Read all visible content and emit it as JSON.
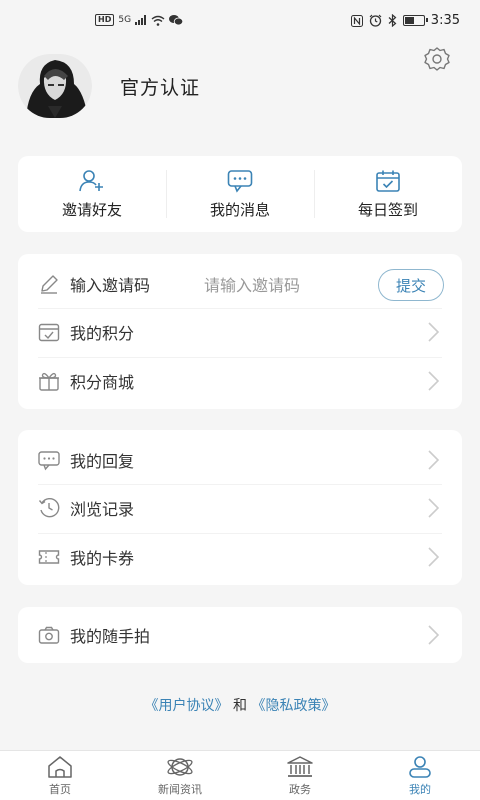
{
  "status_bar": {
    "hd": "HD",
    "network": "5G",
    "time": "3:35"
  },
  "profile": {
    "username": "官方认证"
  },
  "quick_actions": [
    {
      "label": "邀请好友",
      "icon": "add-user-icon"
    },
    {
      "label": "我的消息",
      "icon": "message-icon"
    },
    {
      "label": "每日签到",
      "icon": "calendar-check-icon"
    }
  ],
  "invite": {
    "label": "输入邀请码",
    "placeholder": "请输入邀请码",
    "submit_label": "提交"
  },
  "list1": [
    {
      "label": "我的积分",
      "icon": "points-icon"
    },
    {
      "label": "积分商城",
      "icon": "gift-icon"
    }
  ],
  "list2": [
    {
      "label": "我的回复",
      "icon": "reply-icon"
    },
    {
      "label": "浏览记录",
      "icon": "history-icon"
    },
    {
      "label": "我的卡券",
      "icon": "ticket-icon"
    }
  ],
  "list3": [
    {
      "label": "我的随手拍",
      "icon": "camera-icon"
    }
  ],
  "agreements": {
    "user_agreement": "《用户协议》",
    "and": "和",
    "privacy_policy": "《隐私政策》"
  },
  "tabs": [
    {
      "label": "首页",
      "icon": "home-icon",
      "active": false
    },
    {
      "label": "新闻资讯",
      "icon": "news-icon",
      "active": false
    },
    {
      "label": "政务",
      "icon": "government-icon",
      "active": false
    },
    {
      "label": "我的",
      "icon": "user-icon",
      "active": true
    }
  ],
  "colors": {
    "accent": "#3b83b5",
    "background": "#f5f5f5",
    "card": "#ffffff"
  }
}
